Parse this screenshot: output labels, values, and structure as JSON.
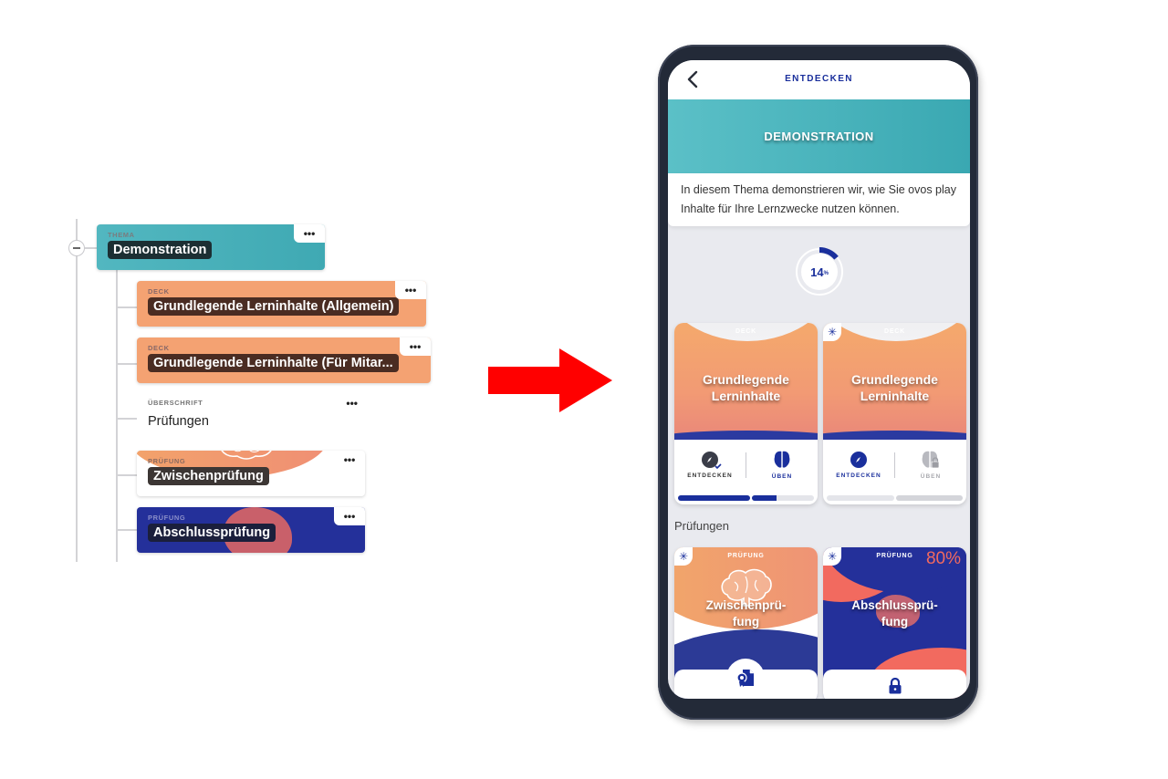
{
  "editor": {
    "nodes": [
      {
        "type": "THEMA",
        "title": "Demonstration",
        "more": "•••"
      },
      {
        "type": "DECK",
        "title": "Grundlegende Lerninhalte (Allgemein)",
        "more": "•••"
      },
      {
        "type": "DECK",
        "title": "Grundlegende Lerninhalte (Für Mitar...",
        "more": "•••"
      },
      {
        "type": "ÜBERSCHRIFT",
        "title": "Prüfungen",
        "more": "•••"
      },
      {
        "type": "PRÜFUNG",
        "title": "Zwischenprüfung",
        "more": "•••"
      },
      {
        "type": "PRÜFUNG",
        "title": "Abschlussprüfung",
        "more": "•••"
      }
    ],
    "collapse_icon": "minus-circle-icon"
  },
  "arrow": {
    "icon": "right-arrow-icon",
    "color": "#ff0000"
  },
  "app": {
    "header": {
      "title": "ENTDECKEN",
      "back_icon": "chevron-left-icon"
    },
    "hero": {
      "title": "DEMONSTRATION",
      "color": "#4ab5bd"
    },
    "description": "In diesem Thema demonstrieren wir, wie Sie ovos play Inhalte für Ihre Lernzwecke nutzen können.",
    "progress": {
      "value": 14,
      "unit": "%",
      "color": "#1a2f9c"
    },
    "decks": [
      {
        "kicker": "DECK",
        "title_line1": "Grundlegende",
        "title_line2": "Lerninhalte",
        "new_badge": false,
        "actions": [
          {
            "label": "ENTDECKEN",
            "icon": "compass-check-icon",
            "state": "done"
          },
          {
            "label": "ÜBEN",
            "icon": "brain-icon",
            "state": "active"
          }
        ],
        "progress_segments": [
          1.0,
          1.0,
          0.4
        ]
      },
      {
        "kicker": "DECK",
        "title_line1": "Grundlegende",
        "title_line2": "Lerninhalte",
        "new_badge": true,
        "badge_icon": "sparkle-icon",
        "actions": [
          {
            "label": "ENTDECKEN",
            "icon": "compass-icon",
            "state": "active"
          },
          {
            "label": "ÜBEN",
            "icon": "brain-lock-icon",
            "state": "locked"
          }
        ],
        "progress_segments": [
          0.0,
          0.0
        ]
      }
    ],
    "section_label": "Prüfungen",
    "exams": [
      {
        "kicker": "PRÜFUNG",
        "title_line1": "Zwischenprü-",
        "title_line2": "fung",
        "badge_icon": "sparkle-icon",
        "footer_icon": "certificate-document-icon"
      },
      {
        "kicker": "PRÜFUNG",
        "title_line1": "Abschlussprü-",
        "title_line2": "fung",
        "badge_icon": "sparkle-icon",
        "score": "80%",
        "footer_icon": "lock-icon"
      }
    ],
    "colors": {
      "primary": "#1a2f9c",
      "deck_orange": "#f4a272",
      "exam_navy": "#24309a",
      "coral": "#f26a5f"
    }
  }
}
